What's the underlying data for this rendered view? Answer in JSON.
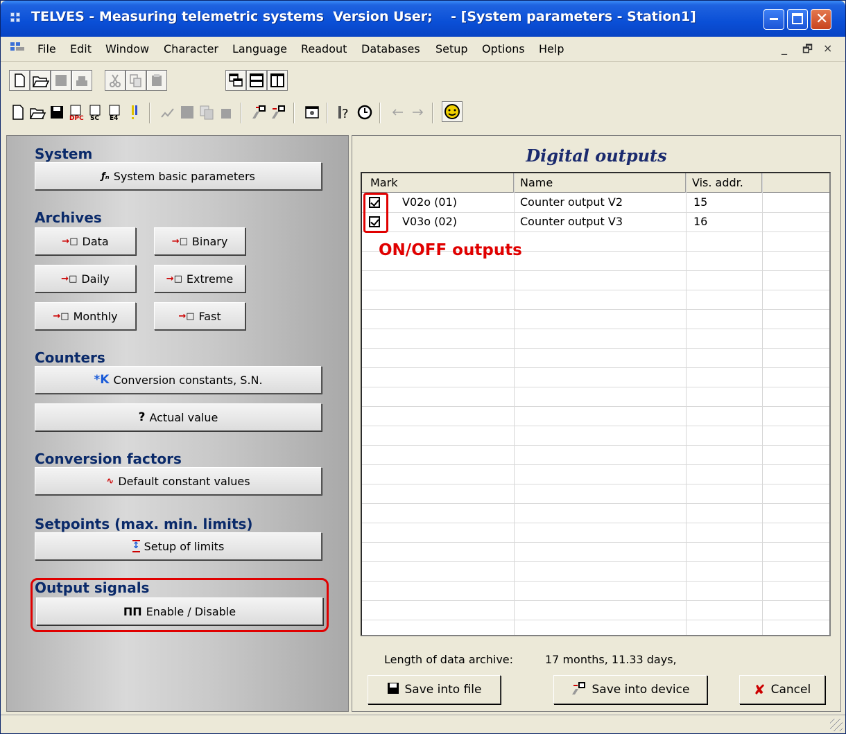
{
  "window": {
    "title": "TELVES - Measuring telemetric systems  Version User;    - [System parameters - Station1]",
    "buttons": [
      "minimize-icon",
      "maximize-icon",
      "close-icon"
    ]
  },
  "menu": {
    "items": [
      "File",
      "Edit",
      "Window",
      "Character",
      "Language",
      "Readout",
      "Databases",
      "Setup",
      "Options",
      "Help"
    ],
    "mdi_controls": [
      "_",
      "🗗",
      "×"
    ]
  },
  "toolbar1": {
    "icons": [
      "new-document-icon",
      "open-folder-icon",
      "save-disabled-icon",
      "print-disabled-icon",
      "cut-disabled-icon",
      "copy-disabled-icon",
      "paste-disabled-icon",
      "cascade-windows-icon",
      "tile-horizontal-icon",
      "tile-vertical-icon"
    ]
  },
  "toolbar2": {
    "icons": [
      "new-icon",
      "open-icon",
      "save-icon",
      "dpc-icon",
      "sc-icon",
      "e4-icon",
      "alert-icon",
      "chart-disabled-icon",
      "grid-disabled-icon",
      "copy-disabled-icon",
      "paste-disabled-icon",
      "readout-icon",
      "write-device-icon",
      "settings-window-icon",
      "help-icon",
      "clock-icon",
      "back-arrow-icon",
      "forward-arrow-icon",
      "smiley-icon"
    ]
  },
  "left": {
    "sections": {
      "system": "System",
      "archives": "Archives",
      "counters": "Counters",
      "conversion": "Conversion factors",
      "setpoints": "Setpoints (max. min. limits)",
      "output": "Output signals"
    },
    "buttons": {
      "system_basic": "System basic parameters",
      "data": "Data",
      "binary": "Binary",
      "daily": "Daily",
      "extreme": "Extreme",
      "monthly": "Monthly",
      "fast": "Fast",
      "conversion_constants": "Conversion constants, S.N.",
      "actual_value": "Actual value",
      "default_constant": "Default constant values",
      "setup_limits": "Setup of limits",
      "enable_disable": "Enable / Disable"
    },
    "button_icons": {
      "system_basic": "fn-icon",
      "conversion_constants": "*K",
      "actual_value": "?",
      "enable_disable": "ΠΠ"
    }
  },
  "right": {
    "title": "Digital outputs",
    "columns": [
      "Mark",
      "Name",
      "Vis. addr."
    ],
    "rows": [
      {
        "checked": true,
        "id": "V02o (01)",
        "name": "Counter output V2",
        "addr": "15"
      },
      {
        "checked": true,
        "id": "V03o (02)",
        "name": "Counter output V3",
        "addr": "16"
      }
    ],
    "annotation": "ON/OFF outputs",
    "archive_label": "Length of data archive:",
    "archive_value": "17 months, 11.33 days,",
    "save_file": "Save into file",
    "save_device": "Save into device",
    "cancel": "Cancel"
  },
  "colors": {
    "title_bar": "#0a4fd6",
    "highlight_red": "#e00000",
    "section_title": "#0a2a6a"
  }
}
